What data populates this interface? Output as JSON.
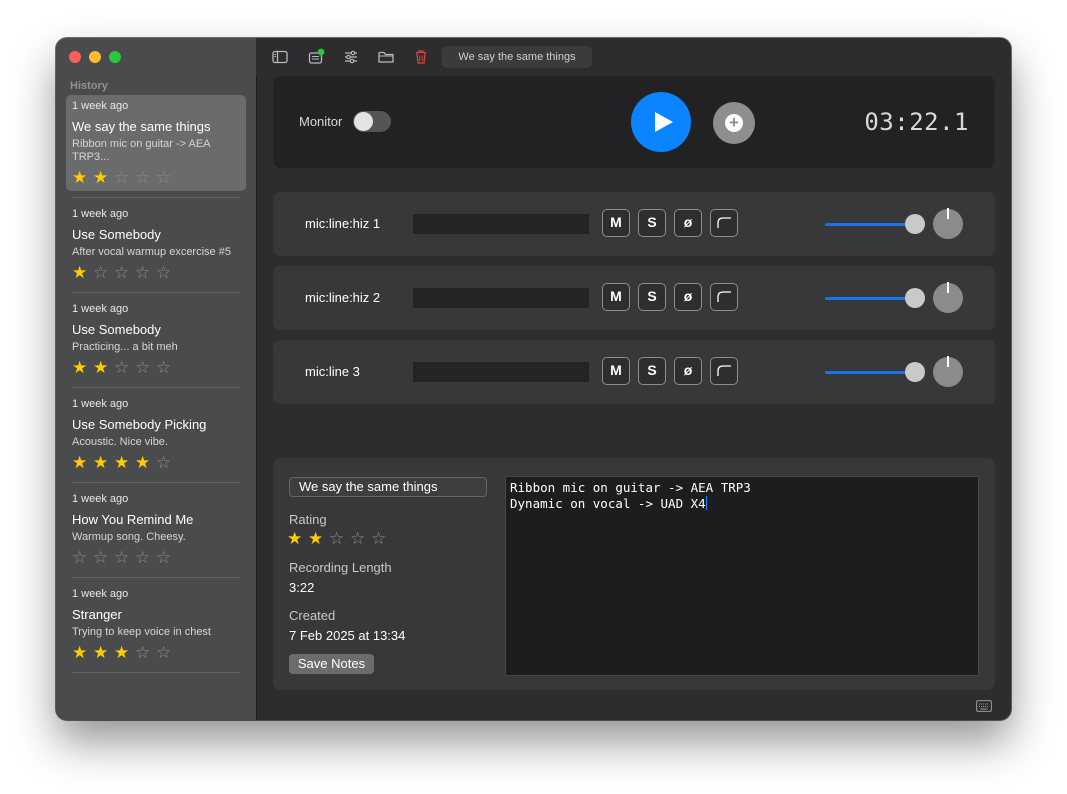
{
  "sidebar": {
    "section_label": "History",
    "items": [
      {
        "ago": "1 week ago",
        "title": "We say the same things",
        "note": "Ribbon mic on guitar -> AEA TRP3...",
        "rating": 2,
        "selected": true
      },
      {
        "ago": "1 week ago",
        "title": "Use Somebody",
        "note": "After vocal warmup excercise #5",
        "rating": 1
      },
      {
        "ago": "1 week ago",
        "title": "Use Somebody",
        "note": "Practicing... a bit meh",
        "rating": 2
      },
      {
        "ago": "1 week ago",
        "title": "Use Somebody Picking",
        "note": "Acoustic. Nice vibe.",
        "rating": 4
      },
      {
        "ago": "1 week ago",
        "title": "How You Remind Me",
        "note": "Warmup song. Cheesy.",
        "rating": 0
      },
      {
        "ago": "1 week ago",
        "title": "Stranger",
        "note": "Trying to keep voice in chest",
        "rating": 3
      }
    ]
  },
  "toolbar": {
    "tab_title": "We say the same things",
    "icons": [
      "sidebar-toggle-icon",
      "recording-status-icon",
      "sliders-icon",
      "folder-icon",
      "trash-icon"
    ]
  },
  "transport": {
    "monitor_label": "Monitor",
    "monitor_on": false,
    "timer": "03:22.1"
  },
  "channels": [
    {
      "name": "mic:line:hiz 1",
      "fader": 0.95
    },
    {
      "name": "mic:line:hiz 2",
      "fader": 0.95
    },
    {
      "name": "mic:line 3",
      "fader": 0.95
    }
  ],
  "channel_buttons": {
    "mute": "M",
    "solo": "S",
    "phase": "ø"
  },
  "notes": {
    "title_value": "We say the same things",
    "rating_label": "Rating",
    "rating": 2,
    "length_label": "Recording Length",
    "length_value": "3:22",
    "created_label": "Created",
    "created_value": "7 Feb 2025 at 13:34",
    "save_label": "Save Notes",
    "text_lines": [
      "Ribbon mic on guitar -> AEA TRP3",
      "Dynamic on vocal -> UAD X4"
    ]
  },
  "colors": {
    "accent": "#0a84ff",
    "star": "#ffcc00",
    "badge": "#28c840",
    "trash": "#d9453b"
  }
}
